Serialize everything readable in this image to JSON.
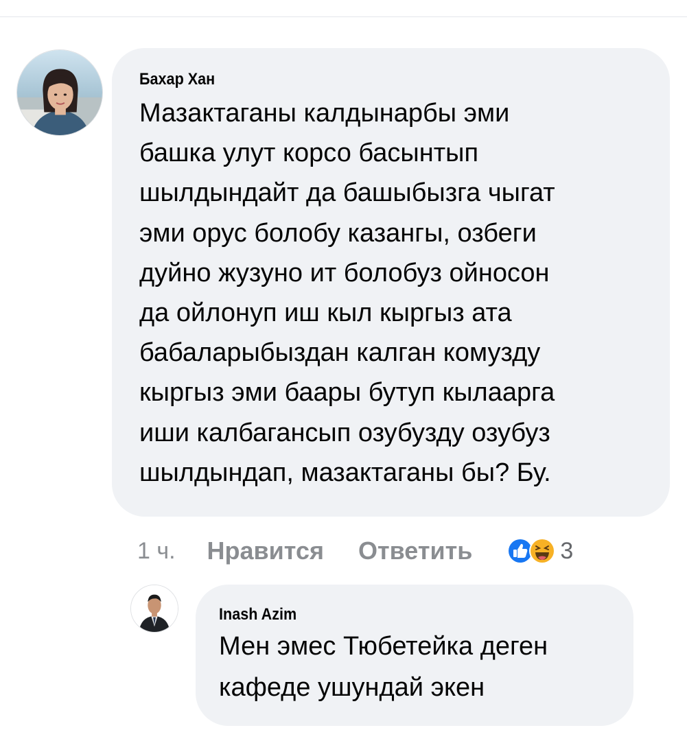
{
  "comment": {
    "author": "Бахар Хан",
    "lines": [
      "Мазактаганы калдынарбы эми",
      "башка улут корсо басынтып",
      "шылдындайт да башыбызга чыгат",
      "эми орус болобу казангы, озбеги",
      "дуйно жузуно ит болобуз ойносон",
      "да ойлонуп иш кыл кыргыз ата",
      "бабаларыбыздан калган комузду",
      "кыргыз эми баары бутуп кылаарга",
      "иши калбагансып озубузду озубуз",
      "шылдындап, мазактаганы бы? Бу."
    ],
    "timestamp": "1 ч.",
    "like_label": "Нравится",
    "reply_label": "Ответить",
    "reactions": {
      "icons": [
        "like-reaction-icon",
        "haha-reaction-icon"
      ],
      "count": "3"
    }
  },
  "reply": {
    "author": "Inash Azim",
    "lines": [
      "Мен эмес Тюбетейка деген",
      "кафеде ушундай экен"
    ]
  },
  "colors": {
    "bubble": "#f0f2f5",
    "like_blue": "#1877f2",
    "haha_yellow": "#f7b125",
    "meta_gray": "#8a8d91"
  }
}
